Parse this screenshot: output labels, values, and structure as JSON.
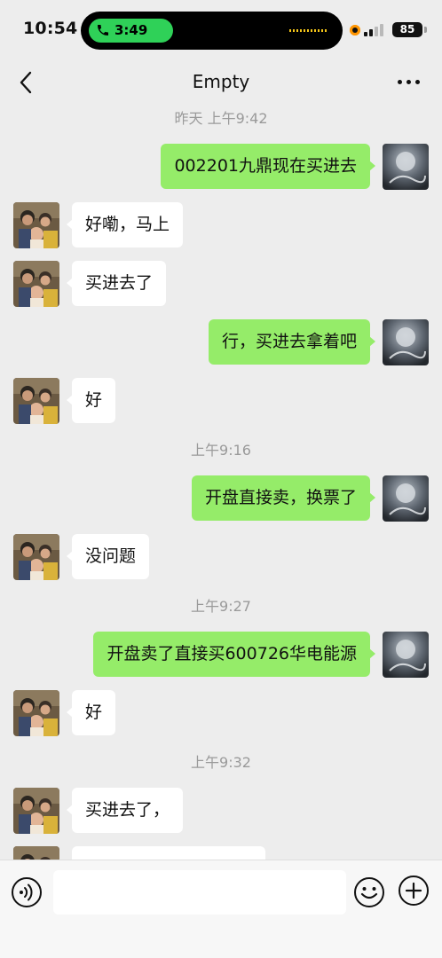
{
  "status_bar": {
    "time": "10:54",
    "call_timer": "3:49",
    "battery": "85",
    "call_color": "#2fd158",
    "recording_color": "#ff9500"
  },
  "header": {
    "title": "Empty",
    "back_icon": "chevron-left-icon",
    "more_icon": "ellipsis-icon"
  },
  "colors": {
    "background": "#ededed",
    "outgoing_bubble": "#95ec69",
    "incoming_bubble": "#ffffff",
    "timestamp_text": "#9a9a9a"
  },
  "messages": [
    {
      "type": "timestamp",
      "text": "昨天 上午9:42"
    },
    {
      "type": "message",
      "side": "out",
      "text": "002201九鼎现在买进去"
    },
    {
      "type": "message",
      "side": "in",
      "text": "好嘞，马上"
    },
    {
      "type": "message",
      "side": "in",
      "text": "买进去了"
    },
    {
      "type": "message",
      "side": "out",
      "text": "行，买进去拿着吧"
    },
    {
      "type": "message",
      "side": "in",
      "text": "好"
    },
    {
      "type": "timestamp",
      "text": "上午9:16"
    },
    {
      "type": "message",
      "side": "out",
      "text": "开盘直接卖，换票了"
    },
    {
      "type": "message",
      "side": "in",
      "text": "没问题"
    },
    {
      "type": "timestamp",
      "text": "上午9:27"
    },
    {
      "type": "message",
      "side": "out",
      "text": "开盘卖了直接买600726华电能源"
    },
    {
      "type": "message",
      "side": "in",
      "text": "好"
    },
    {
      "type": "timestamp",
      "text": "上午9:32"
    },
    {
      "type": "message",
      "side": "in",
      "text": "买进去了，"
    }
  ],
  "input_bar": {
    "placeholder": "",
    "voice_icon": "voice-icon",
    "emoji_icon": "emoji-icon",
    "plus_icon": "plus-circle-icon"
  }
}
